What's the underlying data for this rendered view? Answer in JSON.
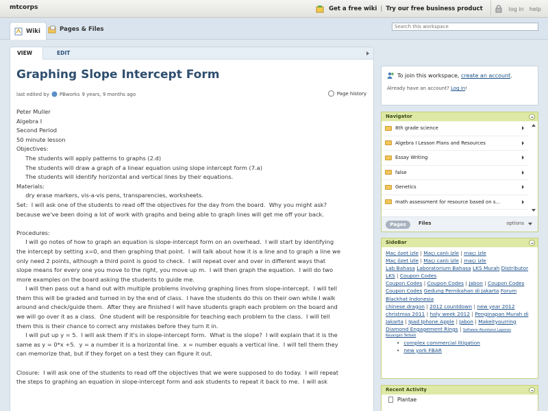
{
  "topbar": {
    "brand": "mtcorps",
    "free_wiki": "Get a free wiki",
    "separator": "|",
    "business": "Try our free business product",
    "login": "log in",
    "help": "help"
  },
  "nav": {
    "wiki_tab": "Wiki",
    "pages_tab": "Pages & Files",
    "search_placeholder": "Search this workspace"
  },
  "main": {
    "tabs": {
      "view": "VIEW",
      "edit": "EDIT"
    },
    "title": "Graphing Slope Intercept Form",
    "meta_prefix": "last edited by",
    "meta_author": "PBworks",
    "meta_time": "9 years, 9 months ago",
    "page_history": "Page history",
    "lines": [
      "Peter Muller",
      "Algebra I",
      "Second Period",
      "50 minute lesson",
      "Objectives:",
      "     The students will apply patterns to graphs (2.d)",
      "     The students will draw a graph of a linear equation using slope intercept form (7.a)",
      "     The students will identify horizontal and vertical lines by their equations.",
      "Materials:",
      "     dry erase markers, vis-a-vis pens, transparencies, worksheets.",
      "Set:  I will ask one of the students to read off the objectives for the day from the board.  Why you might ask?",
      "because we've been doing a lot of work with graphs and being able to graph lines will get me off your back.",
      "",
      "Procedures:",
      "     I will go notes of how to graph an equation is slope-intercept form on an overhead.  I will start by identifying",
      "the intercept by setting x=0, and then graphing that point.  I will talk about how it is a line and to graph a line we",
      "only need 2 points, although a third point is good to check.  I will repeat over and over in different ways that",
      "slope means for every one you move to the right, you move up m.  I will then graph the equation.  I will do two",
      "more examples on the board asking the students to guide me.",
      "     I will then pass out a hand out with multiple problems involving graphing lines from slope-intercept.  I will tell",
      "them this will be graded and turned in by the end of class.  I have the students do this on their own while I walk",
      "around and check/guide them.  After they are finished I will have students graph each problem on the board and",
      "we will go over it as a class.  One student will be responsible for teaching each problem to the class.  I will tell",
      "them this is their chance to correct any mistakes before they turn it in.",
      "     I will put up y = 5.  I will ask them if it's in slope-intercept form.  What is the slope?  I will explain that it is the",
      "same as y = 0*x +5.  y = a number it is a horizontal line.  x = number equals a vertical line.  I will tell them they",
      "can memorize that, but if they forget on a test they can figure it out.",
      "",
      "Closure:  I will ask one of the students to read off the objectives that we were supposed to do today.  I will repeat",
      "the steps to graphing an equation in slope-intercept form and ask students to repeat it back to me.  I will ask"
    ]
  },
  "join": {
    "prefix": "To join this workspace,",
    "link": "create an account",
    "suffix": ".",
    "already": "Already have an account?",
    "login_link": "Log in",
    "login_suffix": "!"
  },
  "navigator": {
    "title": "Navigator",
    "items": [
      "8th grade science",
      "Algebra I Lesson Plans and Resources",
      "Essay Writing",
      "false",
      "Genetics",
      "math assessment for resource based on s..."
    ],
    "pages_pill": "Pages",
    "files": "Files",
    "options": "options"
  },
  "sidebar": {
    "title": "SideBar",
    "links": {
      "l1": "Maç özet izle",
      "l2": "Maçı canlı izle",
      "l3": "maçı izle",
      "l4": "Maç özet izle",
      "l5": "Maçı canlı izle",
      "l6": "maçı izle",
      "l7": "Lab Bahasa",
      "l8": "Laboratorium Bahasa",
      "l9": "LKS Murah",
      "l10": "Distributor",
      "l11": "LKS",
      "l12": "Coupon Codes",
      "l13": "Coupon Codes",
      "l14": "Coupon Codes",
      "l15": "Jabon",
      "l16": "Coupon Codes",
      "l17": "Coupon Codes",
      "l18": "Gedung Pernikahan di Jakarta",
      "l19": "Forum",
      "l20": "Blackhat Indonesia",
      "l21": "chinese dragon",
      "l22": "2012 countdown",
      "l23": "new year 2012",
      "l24": "christmas 2011",
      "l25": "holy week 2012",
      "l26": "Penginapan Murah di",
      "l27": "Jakarta",
      "l28": "Ipad Iphone Apple",
      "l29": "Jabon",
      "l30": "Makeityourring",
      "l31": "Diamond Engagement Rings",
      "l32": "Software Akuntansi Laporan",
      "l33": "Keuangan Terbaik"
    },
    "seps": {
      "pipe": "|",
      "colon_pipe": " | "
    },
    "bullets": [
      "complex commercial litigation",
      "new york FBAR"
    ]
  },
  "recent": {
    "title": "Recent Activity",
    "items": [
      "Plantae"
    ]
  }
}
